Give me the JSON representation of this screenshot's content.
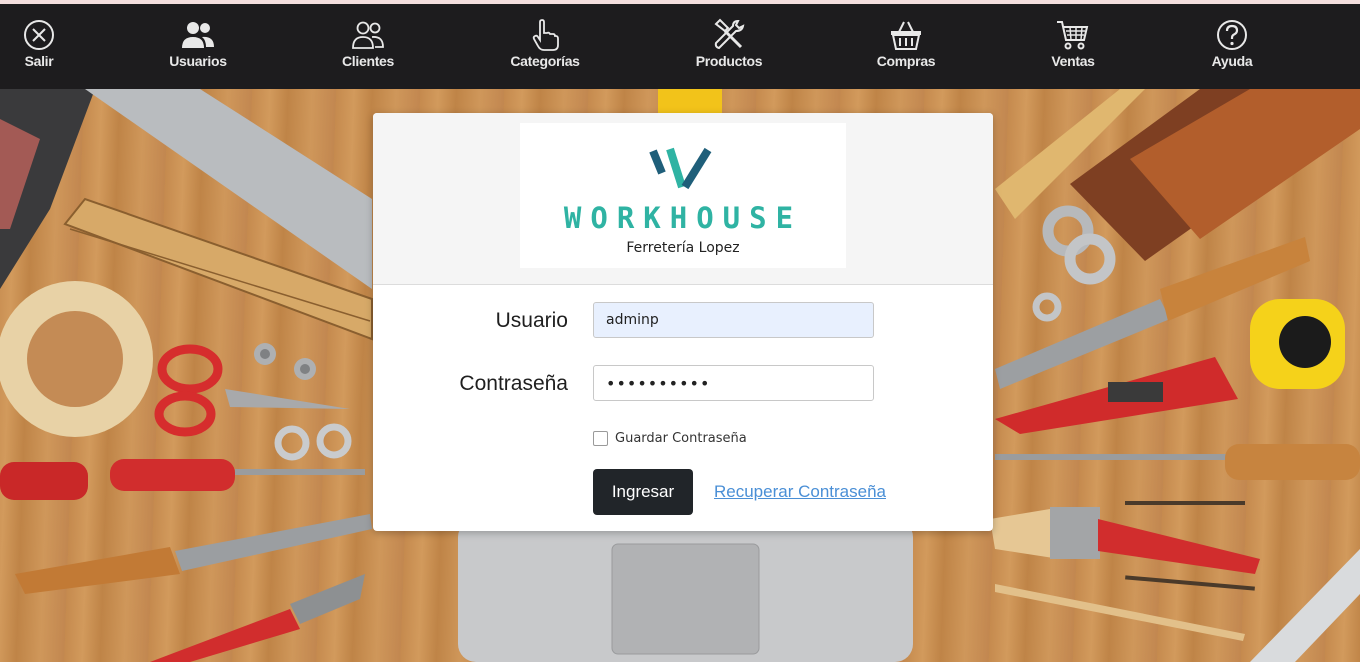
{
  "nav": {
    "items": [
      {
        "label": "Salir",
        "icon": "close-circle-icon"
      },
      {
        "label": "Usuarios",
        "icon": "users-icon"
      },
      {
        "label": "Clientes",
        "icon": "users-outline-icon"
      },
      {
        "label": "Categorías",
        "icon": "pointer-hand-icon"
      },
      {
        "label": "Productos",
        "icon": "tools-icon"
      },
      {
        "label": "Compras",
        "icon": "basket-icon"
      },
      {
        "label": "Ventas",
        "icon": "cart-icon"
      },
      {
        "label": "Ayuda",
        "icon": "question-circle-icon"
      }
    ]
  },
  "logo": {
    "brand": "WORKHOUSE",
    "subtitle": "Ferretería Lopez"
  },
  "form": {
    "username_label": "Usuario",
    "username_value": "adminp",
    "password_label": "Contraseña",
    "password_value": "••••••••••",
    "remember_label": "Guardar Contraseña",
    "remember_checked": false,
    "submit_label": "Ingresar",
    "recover_label": "Recuperar Contraseña"
  },
  "colors": {
    "navbar": "#1d1c1e",
    "accent_teal": "#2fb3a3",
    "logo_dark": "#1f5f7a",
    "button": "#212529",
    "link": "#4a8fd6",
    "autofill": "#e8f0fe"
  }
}
